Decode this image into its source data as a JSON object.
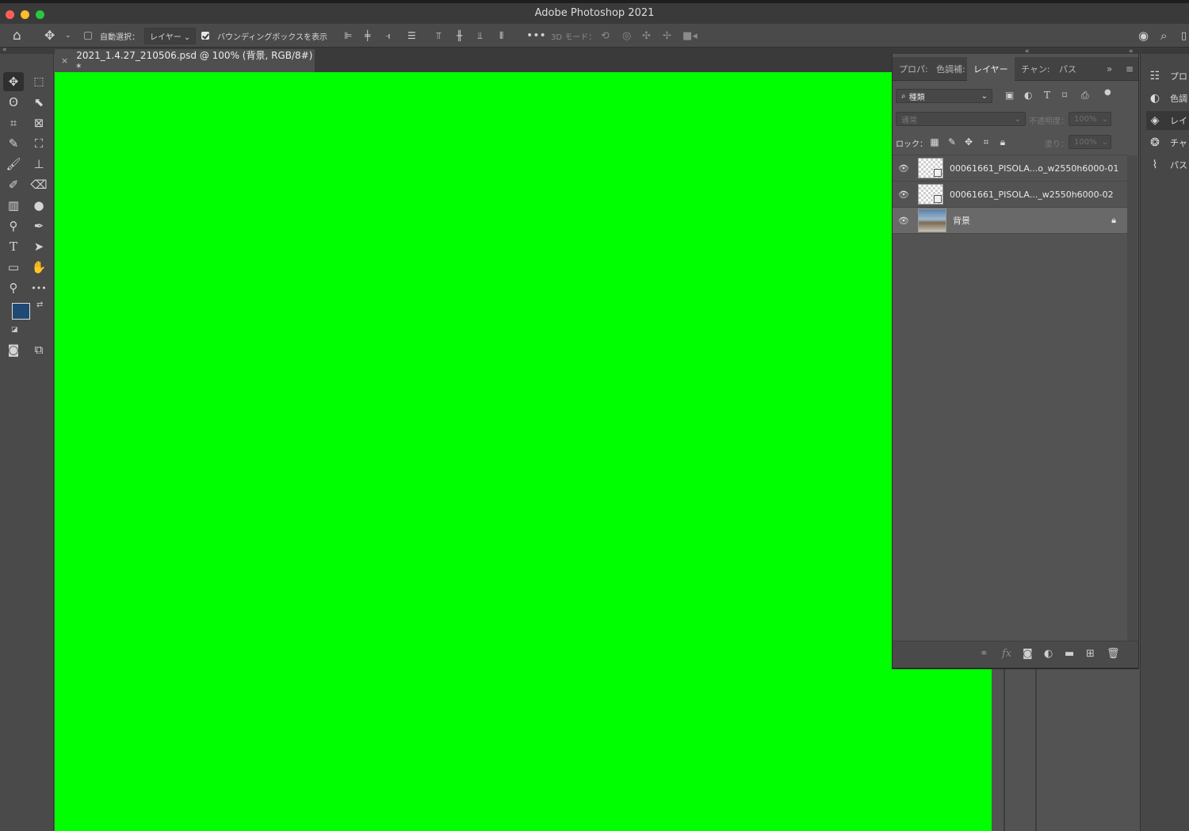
{
  "window": {
    "title": "Adobe Photoshop 2021"
  },
  "options_bar": {
    "auto_select_label": "自動選択：",
    "auto_select_target": "レイヤー",
    "show_bounding_box_label": "バウンディングボックスを表示",
    "bounding_box_checked": true,
    "auto_select_checked": false,
    "mode_3d_label": "3D モード："
  },
  "document": {
    "tab_label": "2021_1.4.27_210506.psd @ 100% (背景, RGB/8#) *",
    "canvas_color": "#00ff00"
  },
  "colors": {
    "foreground": "#1f4a73",
    "background": "#a3360f"
  },
  "layers_panel": {
    "tabs": [
      "プロパ:",
      "色調補:",
      "レイヤー",
      "チャン:",
      "パス"
    ],
    "active_tab": "レイヤー",
    "filter_label": "種類",
    "blend_mode": "通常",
    "opacity_label": "不透明度：",
    "opacity_value": "100%",
    "lock_label": "ロック：",
    "fill_label": "塗り：",
    "fill_value": "100%",
    "layers": [
      {
        "name": "00061661_PISOLA...o_w2550h6000-01",
        "visible": true,
        "type": "smart"
      },
      {
        "name": "00061661_PISOLA..._w2550h6000-02",
        "visible": true,
        "type": "smart"
      },
      {
        "name": "背景",
        "visible": true,
        "type": "background",
        "locked": true,
        "selected": true
      }
    ]
  },
  "right_dock": {
    "items": [
      {
        "label": "プロ",
        "icon": "properties-icon"
      },
      {
        "label": "色調",
        "icon": "adjustments-icon"
      },
      {
        "label": "レイ",
        "icon": "layers-icon"
      },
      {
        "label": "チャ",
        "icon": "channels-icon"
      },
      {
        "label": "パス",
        "icon": "paths-icon"
      }
    ],
    "active_index": 2
  }
}
